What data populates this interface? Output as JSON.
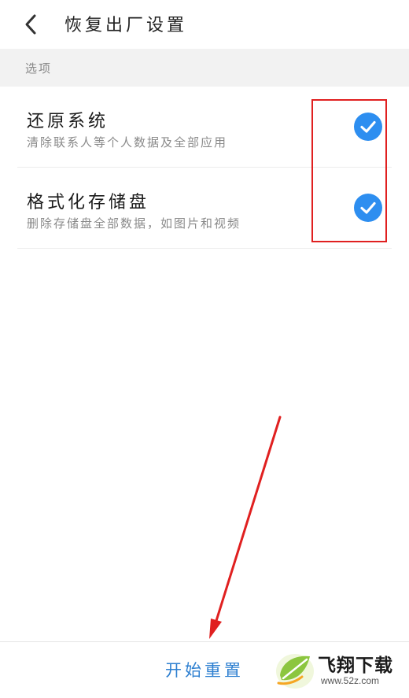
{
  "header": {
    "back_icon": "chevron-left-icon",
    "title": "恢复出厂设置"
  },
  "section": {
    "label": "选项"
  },
  "options": [
    {
      "title": "还原系统",
      "description": "清除联系人等个人数据及全部应用",
      "checked": true
    },
    {
      "title": "格式化存储盘",
      "description": "删除存储盘全部数据，如图片和视频",
      "checked": true
    }
  ],
  "bottom": {
    "reset_label": "开始重置"
  },
  "watermark": {
    "brand": "飞翔下载",
    "url": "www.52z.com"
  },
  "colors": {
    "accent": "#2d8ef0",
    "annotation": "#e02020",
    "reset_text": "#2d7fd0"
  }
}
